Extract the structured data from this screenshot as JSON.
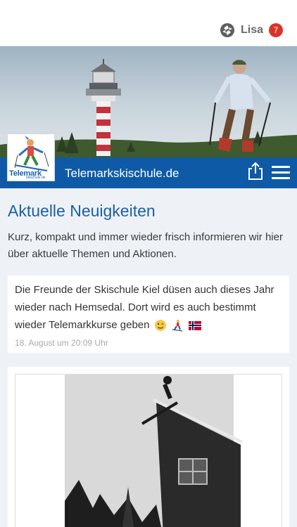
{
  "user": {
    "name": "Lisa",
    "notifications": "7"
  },
  "brand": {
    "title": "Telemarkskischule.de",
    "logo_word": "Telemark",
    "logo_sub": "skischule.de"
  },
  "section": {
    "heading": "Aktuelle Neuigkeiten",
    "intro": "Kurz, kompakt und immer wieder frisch informieren wir hier über aktuelle Themen und Aktionen."
  },
  "posts": [
    {
      "text": "Die Freunde der Skischule Kiel düsen auch dieses Jahr wieder nach Hemsedal. Dort wird es auch bestimmt wieder Telemarkkurse geben",
      "time": "18. August um 20:09 Uhr",
      "emoji": [
        "winking-face",
        "skier",
        "norway-flag"
      ]
    }
  ],
  "icons": [
    "app-logo-icon",
    "share-icon",
    "menu-icon"
  ],
  "colors": {
    "brand_blue": "#0e5aa6",
    "heading_blue": "#1c5ea6",
    "badge_red": "#d9342b",
    "background": "#eef2f7"
  }
}
